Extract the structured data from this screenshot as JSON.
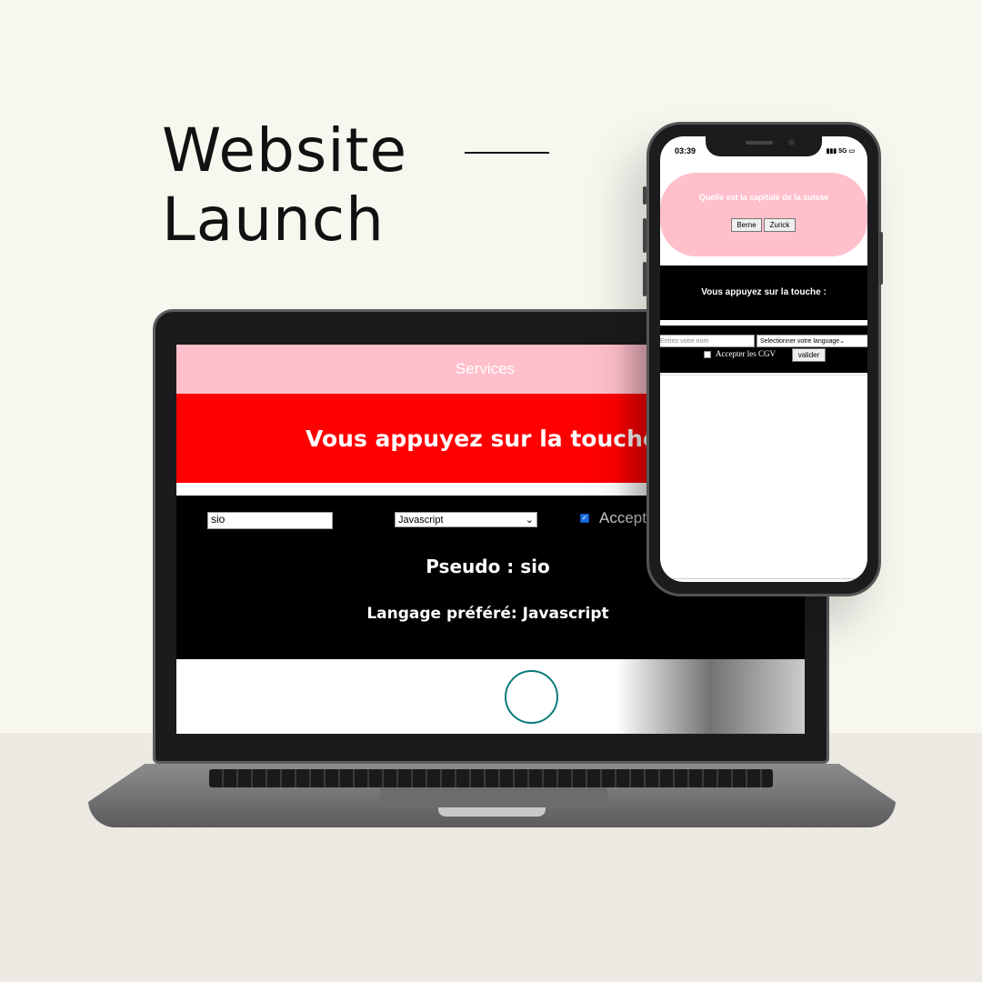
{
  "headline": {
    "line1": "Website",
    "line2": "Launch"
  },
  "laptop": {
    "nav_label": "Services",
    "banner_text": "Vous appuyez sur la touche :",
    "name_input_value": "sio",
    "language_select_value": "Javascript",
    "cgv_label": "Accepter les CGV",
    "pseudo_text": "Pseudo : sio",
    "langpref_text": "Langage préféré: Javascript",
    "checkbox_checked": true
  },
  "phone": {
    "time": "03:39",
    "status": "5G",
    "question": "Quelle est la capitale de la suisse",
    "answers": [
      "Berne",
      "Zurick"
    ],
    "dark_title": "Vous appuyez sur la touche :",
    "name_placeholder": "Entrez votre nom",
    "language_select_value": "Selectionner votre language",
    "cgv_label": "Accepter les CGV",
    "submit_label": "valider"
  },
  "colors": {
    "pink": "#ffbfcb",
    "red": "#ff0000",
    "spinner": "#0b7b78"
  }
}
